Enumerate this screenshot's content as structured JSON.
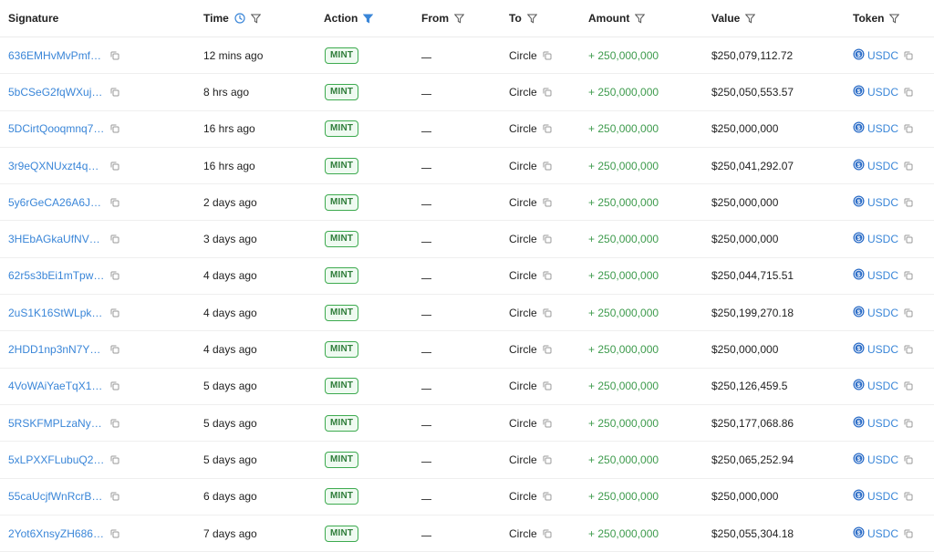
{
  "headers": {
    "signature": "Signature",
    "time": "Time",
    "action": "Action",
    "from": "From",
    "to": "To",
    "amount": "Amount",
    "value": "Value",
    "token": "Token"
  },
  "colors": {
    "link": "#3a86d8",
    "amount": "#3e9b4d",
    "badge_border": "#3daa4f",
    "filter_active": "#3a86d8"
  },
  "icons": {
    "time_header": "clock-icon",
    "filter": "filter-icon",
    "copy": "copy-icon",
    "token": "usdc-coin-icon"
  },
  "rows": [
    {
      "signature": "636EMHvMvPmf7r...",
      "time": "12 mins ago",
      "action": "MINT",
      "from": "—",
      "to": "Circle",
      "amount": "+ 250,000,000",
      "value": "$250,079,112.72",
      "token": "USDC"
    },
    {
      "signature": "5bCSeG2fqWXujw7...",
      "time": "8 hrs ago",
      "action": "MINT",
      "from": "—",
      "to": "Circle",
      "amount": "+ 250,000,000",
      "value": "$250,050,553.57",
      "token": "USDC"
    },
    {
      "signature": "5DCirtQooqmnq7o...",
      "time": "16 hrs ago",
      "action": "MINT",
      "from": "—",
      "to": "Circle",
      "amount": "+ 250,000,000",
      "value": "$250,000,000",
      "token": "USDC"
    },
    {
      "signature": "3r9eQXNUxzt4q9jb...",
      "time": "16 hrs ago",
      "action": "MINT",
      "from": "—",
      "to": "Circle",
      "amount": "+ 250,000,000",
      "value": "$250,041,292.07",
      "token": "USDC"
    },
    {
      "signature": "5y6rGeCA26A6JNc...",
      "time": "2 days ago",
      "action": "MINT",
      "from": "—",
      "to": "Circle",
      "amount": "+ 250,000,000",
      "value": "$250,000,000",
      "token": "USDC"
    },
    {
      "signature": "3HEbAGkaUfNVhnz...",
      "time": "3 days ago",
      "action": "MINT",
      "from": "—",
      "to": "Circle",
      "amount": "+ 250,000,000",
      "value": "$250,000,000",
      "token": "USDC"
    },
    {
      "signature": "62r5s3bEi1mTpw4...",
      "time": "4 days ago",
      "action": "MINT",
      "from": "—",
      "to": "Circle",
      "amount": "+ 250,000,000",
      "value": "$250,044,715.51",
      "token": "USDC"
    },
    {
      "signature": "2uS1K16StWLpkpF...",
      "time": "4 days ago",
      "action": "MINT",
      "from": "—",
      "to": "Circle",
      "amount": "+ 250,000,000",
      "value": "$250,199,270.18",
      "token": "USDC"
    },
    {
      "signature": "2HDD1np3nN7Ycm...",
      "time": "4 days ago",
      "action": "MINT",
      "from": "—",
      "to": "Circle",
      "amount": "+ 250,000,000",
      "value": "$250,000,000",
      "token": "USDC"
    },
    {
      "signature": "4VoWAiYaeTqX1Z6...",
      "time": "5 days ago",
      "action": "MINT",
      "from": "—",
      "to": "Circle",
      "amount": "+ 250,000,000",
      "value": "$250,126,459.5",
      "token": "USDC"
    },
    {
      "signature": "5RSKFMPLzaNy5E...",
      "time": "5 days ago",
      "action": "MINT",
      "from": "—",
      "to": "Circle",
      "amount": "+ 250,000,000",
      "value": "$250,177,068.86",
      "token": "USDC"
    },
    {
      "signature": "5xLPXXFLubuQ2YY...",
      "time": "5 days ago",
      "action": "MINT",
      "from": "—",
      "to": "Circle",
      "amount": "+ 250,000,000",
      "value": "$250,065,252.94",
      "token": "USDC"
    },
    {
      "signature": "55caUcjfWnRcrB5c...",
      "time": "6 days ago",
      "action": "MINT",
      "from": "—",
      "to": "Circle",
      "amount": "+ 250,000,000",
      "value": "$250,000,000",
      "token": "USDC"
    },
    {
      "signature": "2Yot6XnsyZH686e...",
      "time": "7 days ago",
      "action": "MINT",
      "from": "—",
      "to": "Circle",
      "amount": "+ 250,000,000",
      "value": "$250,055,304.18",
      "token": "USDC"
    }
  ]
}
